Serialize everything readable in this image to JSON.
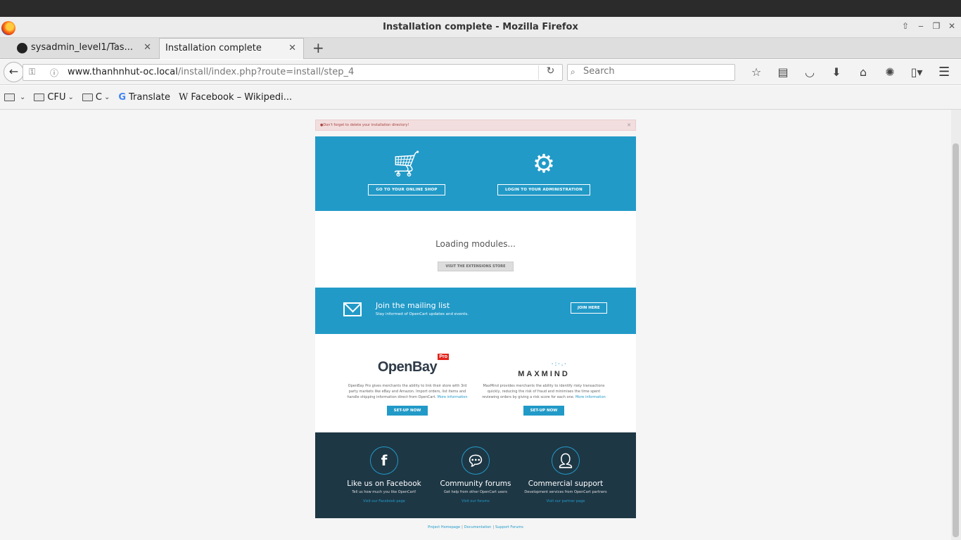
{
  "window": {
    "title": "Installation complete - Mozilla Firefox"
  },
  "tabs": [
    {
      "label": "sysadmin_level1/Tas..."
    },
    {
      "label": "Installation complete"
    }
  ],
  "nav": {
    "url_domain": "www.thanhnhut-oc.local",
    "url_path": "/install/index.php?route=install/step_4",
    "search_placeholder": "Search"
  },
  "bookmarks": [
    {
      "label": "",
      "type": "folder"
    },
    {
      "label": "CFU",
      "type": "folder"
    },
    {
      "label": "C",
      "type": "folder"
    },
    {
      "label": "Translate",
      "type": "link"
    },
    {
      "label": "Facebook – Wikipedi...",
      "type": "link"
    }
  ],
  "page": {
    "alert": "Don't forget to delete your installation directory!",
    "actions": {
      "shop_label": "GO TO YOUR ONLINE SHOP",
      "admin_label": "LOGIN TO YOUR ADMINISTRATION"
    },
    "modules": {
      "loading": "Loading modules...",
      "store_button": "VISIT THE EXTENSIONS STORE"
    },
    "mailing": {
      "title": "Join the mailing list",
      "subtitle": "Stay informed of OpenCart updates and events.",
      "button": "JOIN HERE"
    },
    "partners": [
      {
        "logo": "OpenBay",
        "logo_badge": "Pro",
        "description": "OpenBay Pro gives merchants the ability to link their store with 3rd party markets like eBay and Amazon. Import orders, list items and handle shipping information direct from OpenCart.",
        "more": "More information",
        "button": "SET-UP NOW"
      },
      {
        "logo": "MAXMIND",
        "description": "MaxMind provides merchants the ability to identify risky transactions quickly, reducing the risk of fraud and minimises the time spent reviewing orders by giving a risk score for each one.",
        "more": "More information",
        "button": "SET-UP NOW"
      }
    ],
    "footer": [
      {
        "title": "Like us on Facebook",
        "subtitle": "Tell us how much you like OpenCart!",
        "link": "Visit our Facebook page"
      },
      {
        "title": "Community forums",
        "subtitle": "Get help from other OpenCart users",
        "link": "Visit our forums"
      },
      {
        "title": "Commercial support",
        "subtitle": "Development services from OpenCart partners",
        "link": "Visit our partner page"
      }
    ],
    "bottom_links": [
      "Project Homepage",
      "Documentation",
      "Support Forums"
    ]
  },
  "colors": {
    "accent": "#229ac8",
    "footer_bg": "#1e3745",
    "alert_bg": "#f2dede"
  }
}
